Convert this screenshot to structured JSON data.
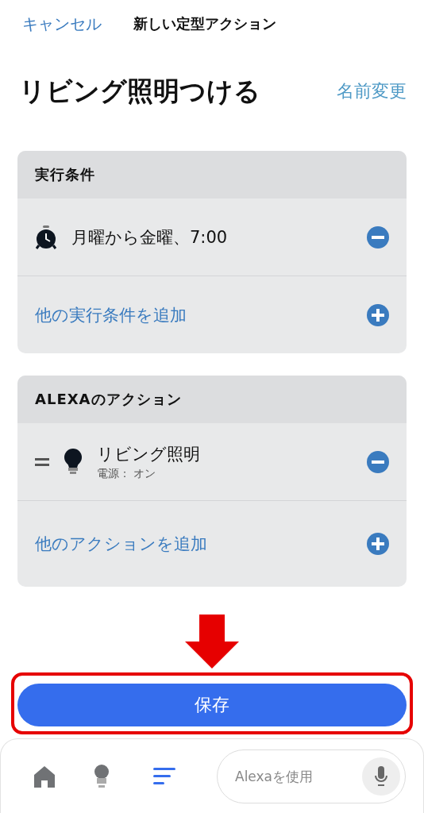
{
  "header": {
    "cancel": "キャンセル",
    "title": "新しい定型アクション"
  },
  "routine": {
    "name": "リビング照明つける",
    "rename": "名前変更"
  },
  "sections": [
    {
      "title": "実行条件",
      "items": [
        {
          "kind": "alarm",
          "reorderable": false,
          "text": "月曜から金曜、7:00"
        }
      ],
      "add": "他の実行条件を追加"
    },
    {
      "title": "ALEXAのアクション",
      "items": [
        {
          "kind": "light",
          "reorderable": true,
          "text": "リビング照明",
          "detail": "電源： オン"
        }
      ],
      "add": "他のアクションを追加"
    }
  ],
  "save": "保存",
  "nav": {
    "tabs": [
      {
        "kind": "home",
        "selected": false
      },
      {
        "kind": "devices",
        "selected": false
      },
      {
        "kind": "routines",
        "selected": true
      }
    ],
    "search": {
      "placeholder": "Alexaを使用"
    }
  }
}
